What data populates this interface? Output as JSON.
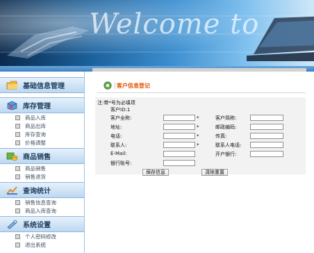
{
  "header": {
    "banner_text": "Welcome to"
  },
  "sidebar": {
    "categories": [
      {
        "label": "基础信息管理",
        "icon": "folder-icon",
        "items": []
      },
      {
        "label": "库存管理",
        "icon": "box-icon",
        "items": [
          "商品入库",
          "商品出库",
          "库存查询",
          "价格调整"
        ]
      },
      {
        "label": "商品销售",
        "icon": "coins-icon",
        "items": [
          "商品销售",
          "销售退货"
        ]
      },
      {
        "label": "查询统计",
        "icon": "chart-icon",
        "items": [
          "销售信息查询",
          "商品入库查询"
        ]
      },
      {
        "label": "系统设置",
        "icon": "settings-icon",
        "items": [
          "个人密码修改",
          "退出系统"
        ]
      }
    ]
  },
  "main": {
    "title": "客户信息登记",
    "note": "注:带*号为必填项",
    "customer_id": "客户ID:1",
    "fields": {
      "full_name": "客户全称:",
      "short_name": "客户简称:",
      "address": "地址:",
      "postcode": "邮政编码:",
      "phone": "电话:",
      "fax": "传真:",
      "contact": "联系人:",
      "contact_phone": "联系人电话:",
      "email": "E-Mail:",
      "bank": "开户银行:",
      "account": "银行账号:"
    },
    "required_mark": "*",
    "buttons": {
      "save": "保存信息",
      "reset": "清除重置"
    }
  },
  "colors": {
    "accent": "#e25400",
    "sidebar_header": "#bcd8f1",
    "banner": "#1a5f9a"
  }
}
